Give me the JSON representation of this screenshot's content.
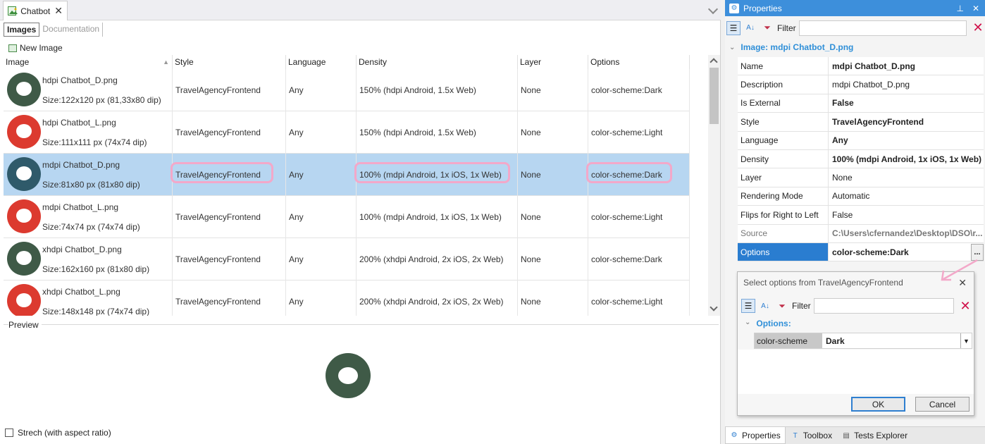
{
  "document_tab": {
    "title": "Chatbot",
    "close_glyph": "✕"
  },
  "sub_tabs": [
    "Images",
    "Documentation"
  ],
  "toolbar": {
    "new_image_label": "New Image"
  },
  "grid": {
    "columns": [
      "Image",
      "Style",
      "Language",
      "Density",
      "Layer",
      "Options"
    ],
    "rows": [
      {
        "name": "hdpi Chatbot_D.png",
        "size": "Size:122x120 px (81,33x80 dip)",
        "style": "TravelAgencyFrontend",
        "language": "Any",
        "density": "150% (hdpi Android, 1.5x Web)",
        "layer": "None",
        "options": "color-scheme:Dark",
        "icon_color": "#3f5a47"
      },
      {
        "name": "hdpi Chatbot_L.png",
        "size": "Size:111x111 px (74x74 dip)",
        "style": "TravelAgencyFrontend",
        "language": "Any",
        "density": "150% (hdpi Android, 1.5x Web)",
        "layer": "None",
        "options": "color-scheme:Light",
        "icon_color": "#dc3a2f"
      },
      {
        "name": "mdpi Chatbot_D.png",
        "size": "Size:81x80 px (81x80 dip)",
        "style": "TravelAgencyFrontend",
        "language": "Any",
        "density": "100% (mdpi Android, 1x iOS, 1x Web)",
        "layer": "None",
        "options": "color-scheme:Dark",
        "icon_color": "#2f5a6a"
      },
      {
        "name": "mdpi Chatbot_L.png",
        "size": "Size:74x74 px (74x74 dip)",
        "style": "TravelAgencyFrontend",
        "language": "Any",
        "density": "100% (mdpi Android, 1x iOS, 1x Web)",
        "layer": "None",
        "options": "color-scheme:Light",
        "icon_color": "#dc3a2f"
      },
      {
        "name": "xhdpi Chatbot_D.png",
        "size": "Size:162x160 px (81x80 dip)",
        "style": "TravelAgencyFrontend",
        "language": "Any",
        "density": "200% (xhdpi Android, 2x iOS, 2x Web)",
        "layer": "None",
        "options": "color-scheme:Dark",
        "icon_color": "#3f5a47"
      },
      {
        "name": "xhdpi Chatbot_L.png",
        "size": "Size:148x148 px (74x74 dip)",
        "style": "TravelAgencyFrontend",
        "language": "Any",
        "density": "200% (xhdpi Android, 2x iOS, 2x Web)",
        "layer": "None",
        "options": "color-scheme:Light",
        "icon_color": "#dc3a2f"
      }
    ],
    "selected_row": 2
  },
  "preview": {
    "label": "Preview",
    "stretch_label": "Strech (with aspect ratio)",
    "checked": false
  },
  "properties": {
    "title": "Properties",
    "filter_label": "Filter",
    "group": "Image: mdpi Chatbot_D.png",
    "rows": [
      {
        "key": "Name",
        "value": "mdpi Chatbot_D.png",
        "bold": true
      },
      {
        "key": "Description",
        "value": "mdpi Chatbot_D.png",
        "bold": false
      },
      {
        "key": "Is External",
        "value": "False",
        "bold": true
      },
      {
        "key": "Style",
        "value": "TravelAgencyFrontend",
        "bold": true
      },
      {
        "key": "Language",
        "value": "Any",
        "bold": true
      },
      {
        "key": "Density",
        "value": "100% (mdpi Android, 1x iOS, 1x Web)",
        "bold": true
      },
      {
        "key": "Layer",
        "value": "None",
        "bold": false
      },
      {
        "key": "Rendering Mode",
        "value": "Automatic",
        "bold": false
      },
      {
        "key": "Flips for Right to Left",
        "value": "False",
        "bold": false
      },
      {
        "key": "Source",
        "value": "C:\\Users\\cfernandez\\Desktop\\DSO\\r...",
        "bold": true,
        "dim": true
      },
      {
        "key": "Options",
        "value": "color-scheme:Dark",
        "bold": true,
        "selected": true
      }
    ],
    "ellipsis": "..."
  },
  "popup": {
    "title": "Select options from TravelAgencyFrontend",
    "filter_label": "Filter",
    "group": "Options:",
    "option_key": "color-scheme",
    "option_value": "Dark",
    "ok_label": "OK",
    "cancel_label": "Cancel"
  },
  "bottom_tabs": [
    "Properties",
    "Toolbox",
    "Tests Explorer"
  ],
  "colors": {
    "selection": "#b7d6f1",
    "accent": "#3d8fdb",
    "highlight": "#f3a8c9"
  }
}
